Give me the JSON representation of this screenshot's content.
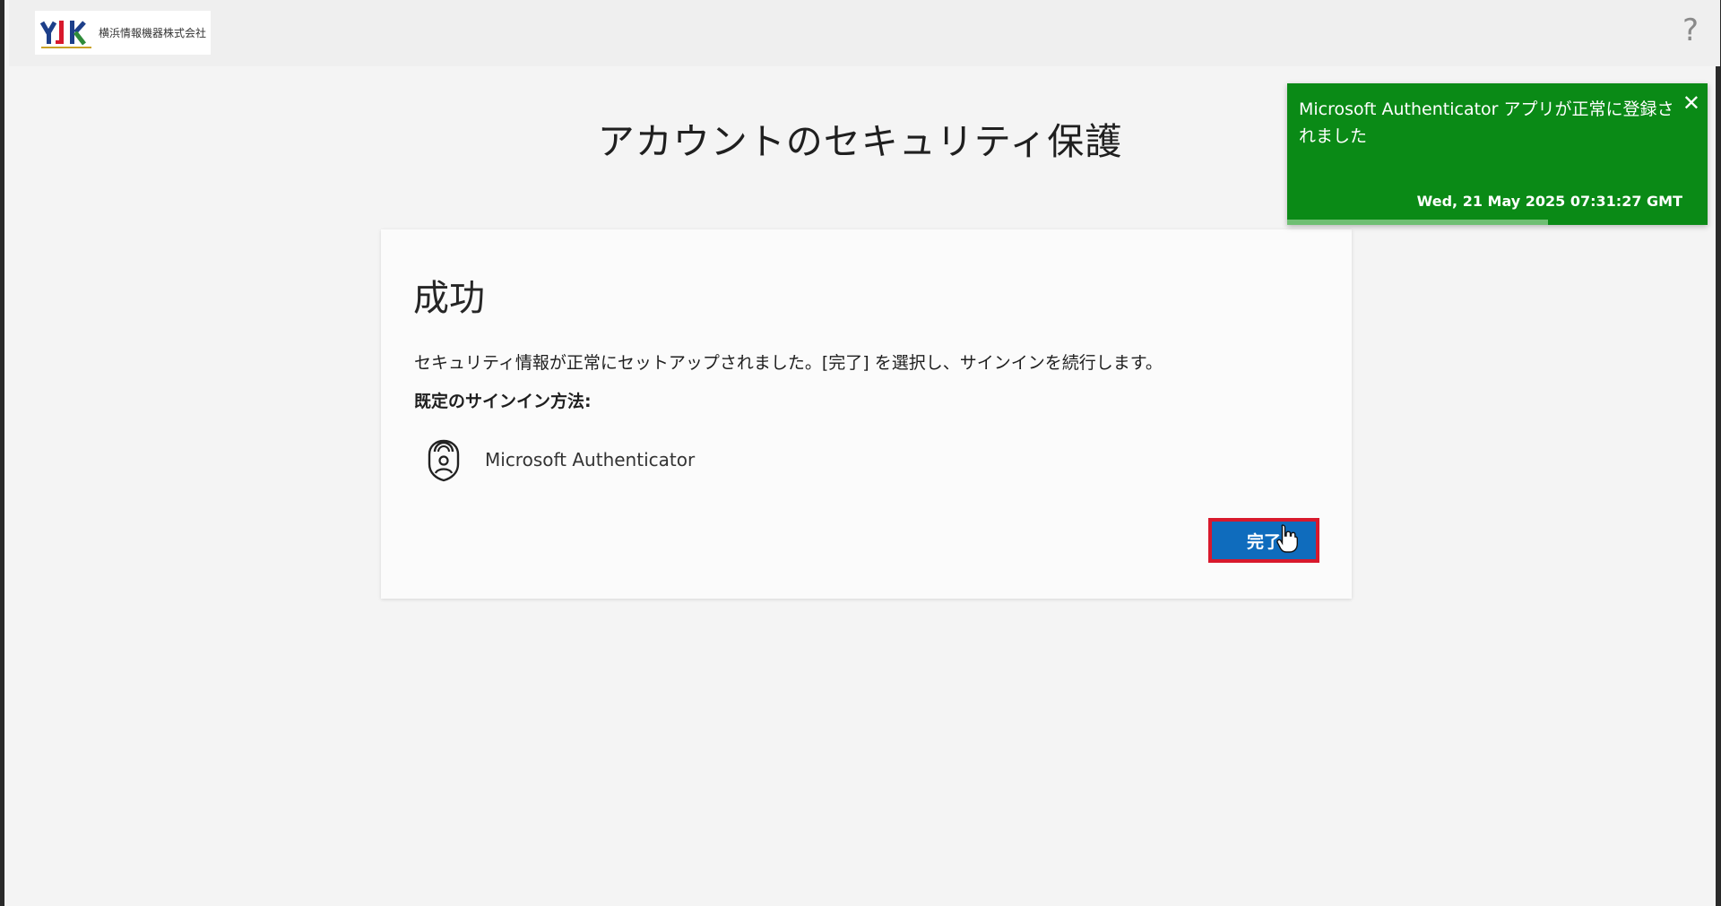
{
  "header": {
    "logo_text": "横浜情報機器株式会社",
    "help_label": "?"
  },
  "page": {
    "title": "アカウントのセキュリティ保護"
  },
  "card": {
    "title": "成功",
    "description": "セキュリティ情報が正常にセットアップされました。[完了] を選択し、サインインを続行します。",
    "default_method_label": "既定のサインイン方法:",
    "method_name": "Microsoft Authenticator",
    "method_icon": "authenticator-lock-icon",
    "done_label": "完了"
  },
  "toast": {
    "message": "Microsoft Authenticator アプリが正常に登録されました",
    "timestamp": "Wed, 21 May 2025 07:31:27 GMT",
    "close_label": "✕",
    "progress": 0.62
  },
  "colors": {
    "primary_button": "#0f6cbd",
    "button_focus_border": "#d8192c",
    "toast_background": "#0a8a16"
  }
}
